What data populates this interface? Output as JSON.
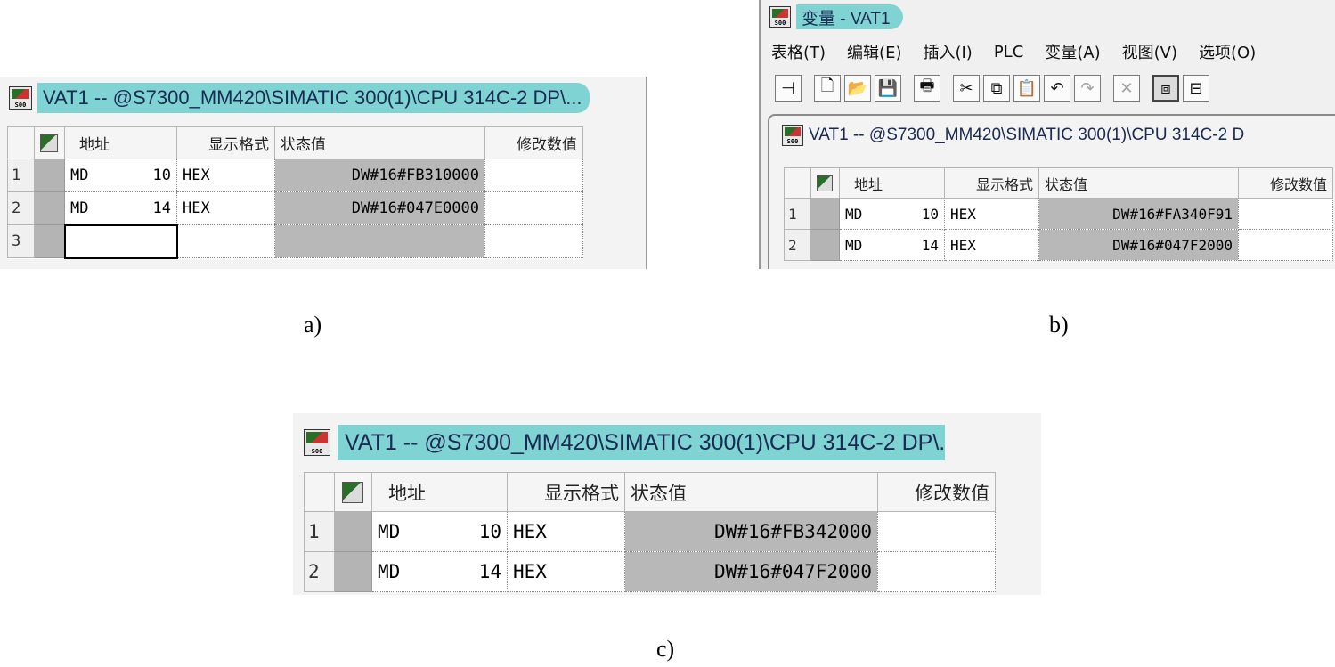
{
  "panel_a": {
    "title": "VAT1 -- @S7300_MM420\\SIMATIC 300(1)\\CPU 314C-2 DP\\...",
    "columns": {
      "address": "地址",
      "format": "显示格式",
      "status": "状态值",
      "modify": "修改数值"
    },
    "rows": [
      {
        "num": "1",
        "operand": "MD",
        "addr": "10",
        "format": "HEX",
        "status": "DW#16#FB310000",
        "modify": ""
      },
      {
        "num": "2",
        "operand": "MD",
        "addr": "14",
        "format": "HEX",
        "status": "DW#16#047E0000",
        "modify": ""
      },
      {
        "num": "3",
        "operand": "",
        "addr": "",
        "format": "",
        "status": "",
        "modify": ""
      }
    ],
    "caption": "a)"
  },
  "panel_b": {
    "app_title": "变量 - VAT1",
    "menu": [
      "表格(T)",
      "编辑(E)",
      "插入(I)",
      "PLC",
      "变量(A)",
      "视图(V)",
      "选项(O)"
    ],
    "toolbar_icons": [
      "pin-icon",
      "new-icon",
      "open-icon",
      "save-icon",
      "print-icon",
      "cut-icon",
      "copy-icon",
      "paste-icon",
      "undo-icon",
      "redo-icon",
      "delete-icon",
      "monitor-icon",
      "connect-icon"
    ],
    "title": "VAT1 -- @S7300_MM420\\SIMATIC 300(1)\\CPU 314C-2 D",
    "columns": {
      "address": "地址",
      "format": "显示格式",
      "status": "状态值",
      "modify": "修改数值"
    },
    "rows": [
      {
        "num": "1",
        "operand": "MD",
        "addr": "10",
        "format": "HEX",
        "status": "DW#16#FA340F91",
        "modify": ""
      },
      {
        "num": "2",
        "operand": "MD",
        "addr": "14",
        "format": "HEX",
        "status": "DW#16#047F2000",
        "modify": ""
      }
    ],
    "caption": "b)"
  },
  "panel_c": {
    "title": "VAT1 -- @S7300_MM420\\SIMATIC 300(1)\\CPU 314C-2 DP\\.",
    "columns": {
      "address": "地址",
      "format": "显示格式",
      "status": "状态值",
      "modify": "修改数值"
    },
    "rows": [
      {
        "num": "1",
        "operand": "MD",
        "addr": "10",
        "format": "HEX",
        "status": "DW#16#FB342000",
        "modify": ""
      },
      {
        "num": "2",
        "operand": "MD",
        "addr": "14",
        "format": "HEX",
        "status": "DW#16#047F2000",
        "modify": ""
      }
    ],
    "caption": "c)"
  },
  "colors": {
    "title_pill": "#7fd3d3",
    "status_cell": "#b8b8b8",
    "gutter": "#b4b4b4"
  }
}
